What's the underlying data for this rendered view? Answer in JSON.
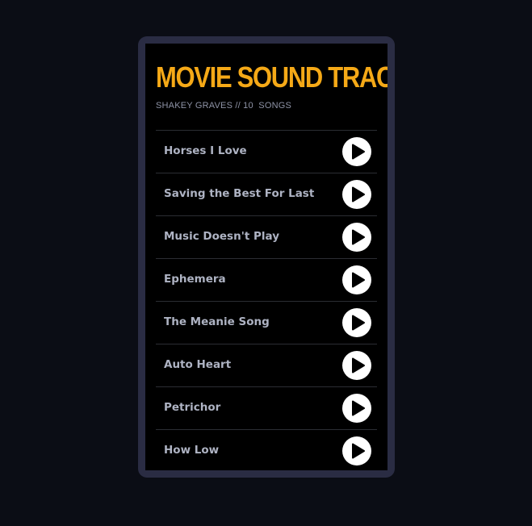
{
  "header": {
    "title": "MOVIE SOUND TRACK",
    "subtitle": "SHAKEY GRAVES // 10  SONGS"
  },
  "songs": [
    {
      "title": "Horses I Love",
      "action_icon": "play-icon"
    },
    {
      "title": "Saving the Best For Last",
      "action_icon": "play-icon"
    },
    {
      "title": "Music Doesn't Play",
      "action_icon": "play-icon"
    },
    {
      "title": "Ephemera",
      "action_icon": "play-icon"
    },
    {
      "title": "The Meanie Song",
      "action_icon": "play-icon"
    },
    {
      "title": "Auto Heart",
      "action_icon": "play-icon"
    },
    {
      "title": "Petrichor",
      "action_icon": "play-icon"
    },
    {
      "title": "How Low",
      "action_icon": "play-icon"
    }
  ],
  "colors": {
    "page_background": "#0b0d15",
    "card_frame": "#2a2c43",
    "card_background": "#000000",
    "title_accent": "#f5a917",
    "song_text": "#aeb3c3",
    "play_button": "#ffffff"
  }
}
